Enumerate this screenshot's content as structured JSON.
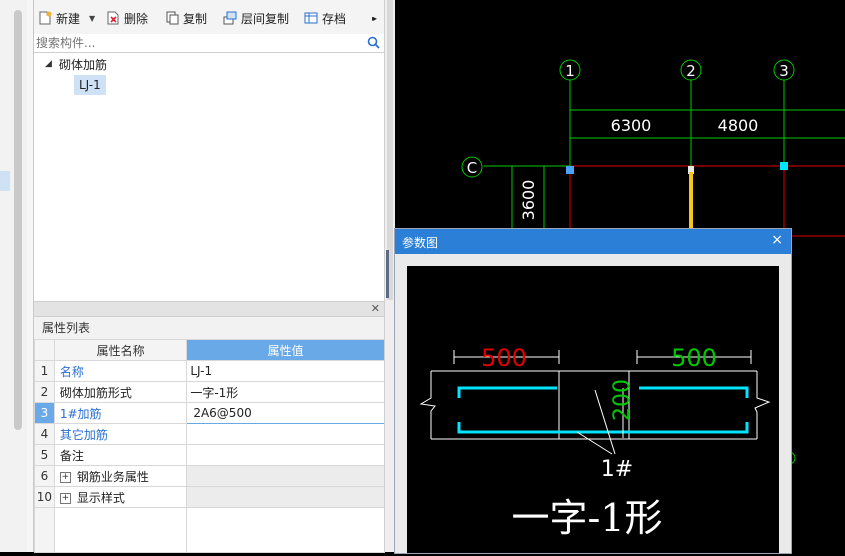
{
  "toolbar": {
    "new_label": "新建",
    "delete_label": "删除",
    "copy_label": "复制",
    "floor_copy_label": "层间复制",
    "archive_label": "存档",
    "more_glyph": "▸▸"
  },
  "search": {
    "placeholder": "搜索构件..."
  },
  "tree": {
    "root_label": "砌体加筋",
    "child_label": "LJ-1"
  },
  "properties": {
    "title": "属性列表",
    "col_name": "属性名称",
    "col_value": "属性值",
    "rows": [
      {
        "num": "1",
        "name": "名称",
        "value": "LJ-1"
      },
      {
        "num": "2",
        "name": "砌体加筋形式",
        "value": "一字-1形"
      },
      {
        "num": "3",
        "name": "1#加筋",
        "value": "2A6@500"
      },
      {
        "num": "4",
        "name": "其它加筋",
        "value": ""
      },
      {
        "num": "5",
        "name": "备注",
        "value": ""
      },
      {
        "num": "6",
        "name": "钢筋业务属性",
        "value": ""
      },
      {
        "num": "10",
        "name": "显示样式",
        "value": ""
      }
    ]
  },
  "cad": {
    "axis_1": "1",
    "axis_2": "2",
    "axis_3": "3",
    "axis_c": "C",
    "dim_1": "6300",
    "dim_2": "4800",
    "dim_vertical": "3600"
  },
  "dialog": {
    "title": "参数图",
    "close_glyph": "×",
    "dim_left": "500",
    "dim_right": "500",
    "dim_center": "200",
    "bar_label": "1#",
    "shape_label": "一字-1形"
  },
  "colors": {
    "accent": "#2b7fd6",
    "cad_green": "#00c800",
    "cad_red": "#e00000",
    "cad_cyan": "#00e5ff"
  }
}
